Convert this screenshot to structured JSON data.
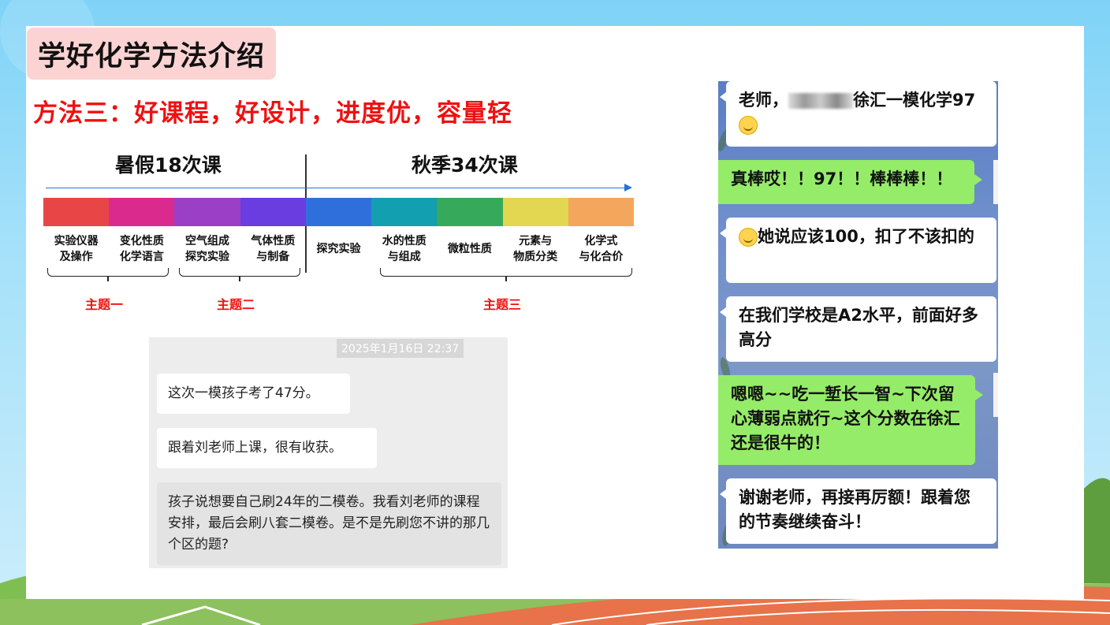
{
  "slide": {
    "title": "学好化学方法介绍",
    "subtitle": "方法三：好课程，好设计，进度优，容量轻"
  },
  "timeline": {
    "summer_label": "暑假18次课",
    "autumn_label": "秋季34次课",
    "segment_colors": [
      "#e84646",
      "#da2a8e",
      "#9a3fc6",
      "#6a3de0",
      "#2f6fdc",
      "#129fb0",
      "#36a95a",
      "#e3d650",
      "#f4a65c"
    ],
    "topics": [
      "实验仪器\n及操作",
      "变化性质\n化学语言",
      "空气组成\n探究实验",
      "气体性质\n与制备",
      "探究实验",
      "水的性质\n与组成",
      "微粒性质",
      "元素与\n物质分类",
      "化学式\n与化合价"
    ],
    "themes": [
      "主题一",
      "主题二",
      "主题三"
    ]
  },
  "chat_left": {
    "timestamp": "2025年1月16日 22:37",
    "messages": [
      "这次一模孩子考了47分。",
      "跟着刘老师上课，很有收获。",
      "孩子说想要自己刷24年的二模卷。我看刘老师的课程安排，最后会刷八套二模卷。是不是先刷您不讲的那几个区的题?"
    ]
  },
  "chat_right": {
    "messages": [
      {
        "side": "left",
        "prefix": "老师，",
        "text": "徐汇一模化学97",
        "emoji": "smile-emoji"
      },
      {
        "side": "right",
        "text": "真棒哎！！97！！棒棒棒！！"
      },
      {
        "side": "left",
        "emoji": "sweat-emoji",
        "text": "她说应该100，扣了不该扣的"
      },
      {
        "side": "left",
        "text": "在我们学校是A2水平，前面好多高分"
      },
      {
        "side": "right",
        "text": "嗯嗯~~吃一堑长一智~下次留心薄弱点就行~这个分数在徐汇还是很牛的！"
      },
      {
        "side": "left",
        "text": "谢谢老师，再接再厉额！跟着您的节奏继续奋斗！"
      }
    ]
  }
}
